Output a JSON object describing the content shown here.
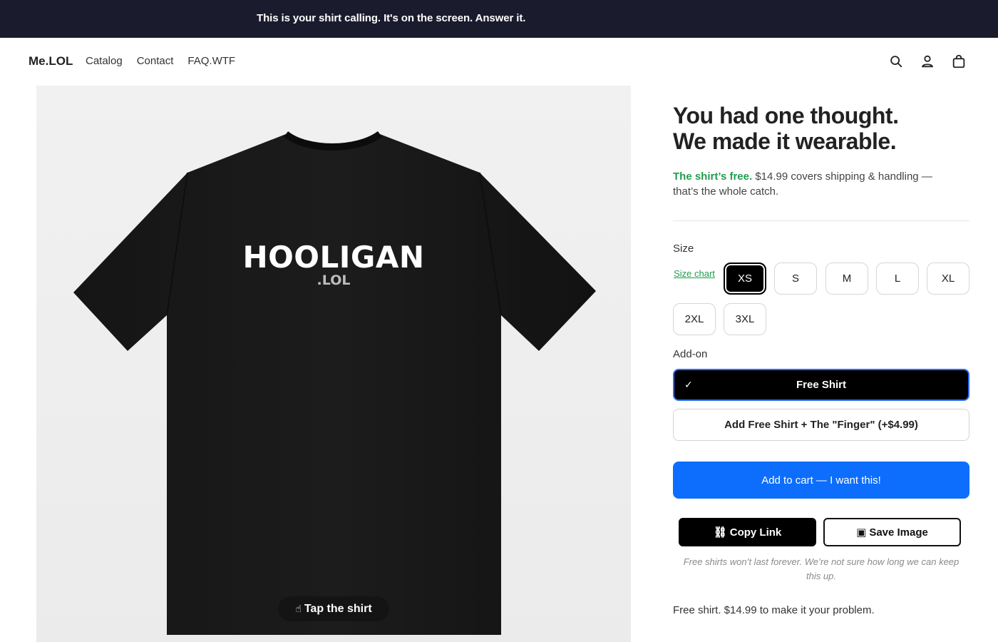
{
  "announcement": {
    "text": "This is your shirt calling. It's on the screen. Answer it."
  },
  "header": {
    "logo": "Me.LOL",
    "nav": [
      {
        "label": "Catalog"
      },
      {
        "label": "Contact"
      },
      {
        "label": "FAQ.WTF"
      }
    ],
    "icons": [
      "search-icon",
      "account-icon",
      "cart-bag-icon"
    ]
  },
  "media": {
    "print_main": "HOOLIGAN",
    "print_sub": ".LOL",
    "tap_label": "Tap the shirt",
    "tap_icon": "hand-pointer-icon"
  },
  "product": {
    "title_line1": "You had one thought.",
    "title_line2": "We made it wearable.",
    "free_text": "The shirt’s free.",
    "price_text": " $14.99 covers shipping & handling — that’s the whole catch.",
    "size_label": "Size",
    "size_chart": "Size chart",
    "sizes": [
      "XS",
      "S",
      "M",
      "L",
      "XL",
      "2XL",
      "3XL"
    ],
    "selected_size": "XS",
    "addon_label": "Add-on",
    "addon_selected": "Free Shirt",
    "addon_selected_check": "✓",
    "addon_other": "Add Free Shirt + The \"Finger\" (+$4.99)",
    "cart_button": "Add to cart — I want this!",
    "copy_link": "Copy Link",
    "save_image": "Save Image",
    "note": "Free shirts won’t last forever. We’re not sure how long we can keep this up.",
    "footline": "Free shirt. $14.99 to make it your problem."
  },
  "colors": {
    "announcement_bg": "#1b1b2e",
    "free_green": "#1f9e4e",
    "cart_blue": "#0d6efd",
    "selected_border": "#2e6cff"
  }
}
